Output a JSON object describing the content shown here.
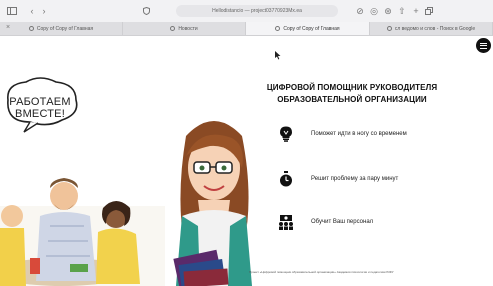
{
  "browser": {
    "url": "Hellodistancio — project03770923Mx.ea",
    "tabs": [
      {
        "label": "Copy of Copy of Главная",
        "active": false,
        "close": "×"
      },
      {
        "label": "Новости",
        "active": false
      },
      {
        "label": "Copy of Copy of Главная",
        "active": true
      },
      {
        "label": "сл ведомо и слов - Поиск в Google",
        "active": false
      }
    ],
    "icons": [
      "sidebar-icon",
      "back-icon",
      "forward-icon",
      "shield-icon",
      "download-icon",
      "extension-icon",
      "share-icon",
      "new-tab-icon",
      "tabs-overview-icon"
    ]
  },
  "page": {
    "bubble": "РАБОТАЕМ ВМЕСТЕ!",
    "heading_line1": "ЦИФРОВОЙ ПОМОЩНИК РУКОВОДИТЕЛЯ",
    "heading_line2": "ОБРАЗОВАТЕЛЬНОЙ ОРГАНИЗАЦИИ",
    "features": [
      {
        "icon": "lightbulb-icon",
        "label": "Поможет идти в ногу со временем"
      },
      {
        "icon": "stopwatch-icon",
        "label": "Решит проблему за пару минут"
      },
      {
        "icon": "people-icon",
        "label": "Обучит Ваш персонал"
      }
    ],
    "footnote": "Проект «Цифровой помощник образовательной организации» Академия психологии и педагогики ЮФУ"
  }
}
